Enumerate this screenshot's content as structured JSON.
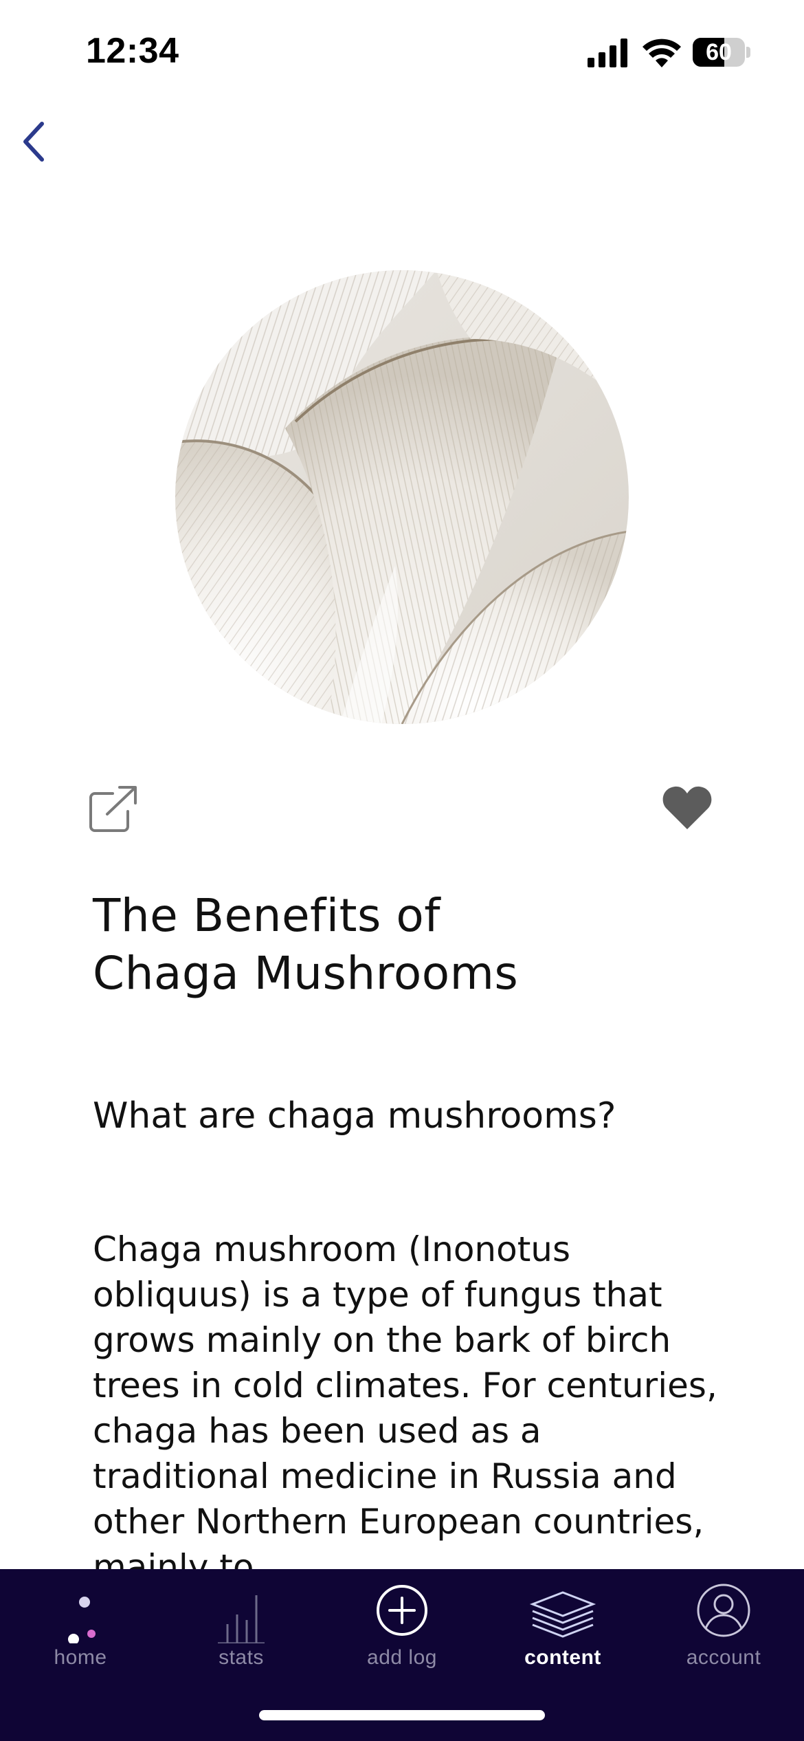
{
  "status_bar": {
    "time": "12:34",
    "battery_level": "60",
    "battery_fraction": 0.6,
    "icons": [
      "signal-icon",
      "wifi-icon",
      "battery-icon"
    ]
  },
  "navigation": {
    "back_icon": "chevron-left-icon",
    "back_color": "#2b3a8c"
  },
  "article": {
    "image_description_icon": "mushroom-gills-image",
    "share_icon": "share-icon",
    "favorite_icon": "heart-icon",
    "favorited": true,
    "title": "The Benefits of Chaga Mushrooms",
    "subheading": "What are chaga mushrooms?",
    "body": "Chaga mushroom (Inonotus obliquus) is a type of fungus that grows mainly on the bark of birch trees in cold climates. For centuries, chaga has been used as a traditional medicine in Russia and other Northern European countries, mainly to"
  },
  "tab_bar": {
    "background": "#0f0535",
    "active_color": "#ffffff",
    "inactive_color": "#8e8aa6",
    "tabs": [
      {
        "label": "home",
        "icon": "home-dots-icon",
        "active": false
      },
      {
        "label": "stats",
        "icon": "bar-chart-icon",
        "active": false
      },
      {
        "label": "add log",
        "icon": "plus-circle-icon",
        "active": false
      },
      {
        "label": "content",
        "icon": "layers-icon",
        "active": true
      },
      {
        "label": "account",
        "icon": "user-circle-icon",
        "active": false
      }
    ]
  }
}
